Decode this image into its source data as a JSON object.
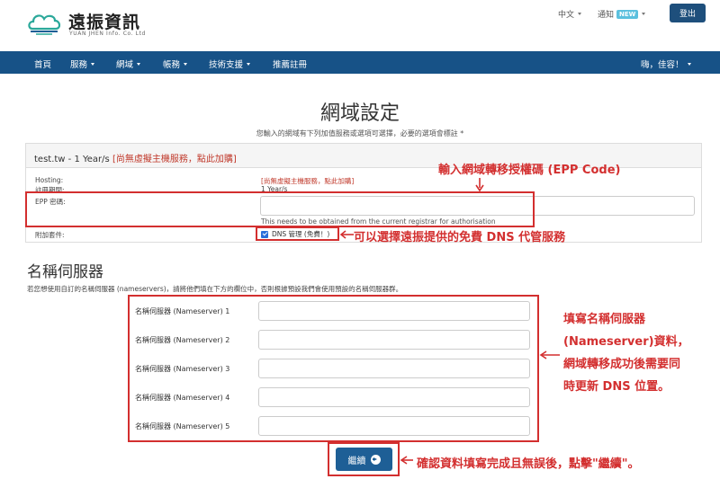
{
  "header": {
    "logo_title": "遠振資訊",
    "logo_subtitle": "YUAN JHEN Info. Co. Ltd",
    "language": "中文",
    "notify_label": "通知",
    "notify_badge": "NEW",
    "logout_label": "登出"
  },
  "nav": {
    "items": [
      {
        "label": "首頁"
      },
      {
        "label": "服務"
      },
      {
        "label": "網域"
      },
      {
        "label": "帳務"
      },
      {
        "label": "技術支援"
      },
      {
        "label": "推薦註冊"
      }
    ],
    "user_greeting": "嗨，佳容！"
  },
  "page": {
    "title": "網域設定",
    "subtitle": "您輸入的網域有下列加值服務或選項可選擇，必要的選項會標註 *"
  },
  "panel": {
    "domain_text": "test.tw - 1 Year/s",
    "hosting_link": "[尚無虛擬主機服務，點此加購]",
    "hosting_label": "Hosting:",
    "hosting_value": "[尚無虛擬主機服務，點此加購]",
    "period_label": "註冊期間:",
    "period_value": "1 Year/s",
    "epp_label": "EPP 密碼:",
    "epp_value": "",
    "epp_help": "This needs to be obtained from the current registrar for authorisation",
    "addon_label": "附加套件:",
    "dns_option": "DNS 管理 (免費！)"
  },
  "nameservers": {
    "title": "名稱伺服器",
    "description": "若您想使用自訂的名稱伺服器 (nameservers)，請將他們填在下方的欄位中，否則根據預設我們會使用預設的名稱伺服器群。",
    "fields": [
      {
        "label": "名稱伺服器 (Nameserver) 1",
        "value": ""
      },
      {
        "label": "名稱伺服器 (Nameserver) 2",
        "value": ""
      },
      {
        "label": "名稱伺服器 (Nameserver) 3",
        "value": ""
      },
      {
        "label": "名稱伺服器 (Nameserver) 4",
        "value": ""
      },
      {
        "label": "名稱伺服器 (Nameserver) 5",
        "value": ""
      }
    ],
    "continue_label": "繼續"
  },
  "annotations": {
    "epp_note": "輸入網域轉移授權碼 (EPP Code)",
    "dns_note": "可以選擇遠振提供的免費 DNS 代管服務",
    "ns_note_lines": [
      "填寫名稱伺服器",
      "(Nameserver)資料，",
      "網域轉移成功後需要同",
      "時更新 DNS 位置。"
    ],
    "continue_note": "確認資料填寫完成且無誤後，點擊\"繼續\"。"
  },
  "colors": {
    "nav_bg": "#175287",
    "annotation_red": "#d32f2f",
    "badge_new": "#5bc0de",
    "button_blue": "#1e5f96"
  },
  "icons": [
    "cloud-logo-icon",
    "caret-down-icon",
    "checkbox-checked-icon",
    "arrow-right-circle-icon"
  ]
}
